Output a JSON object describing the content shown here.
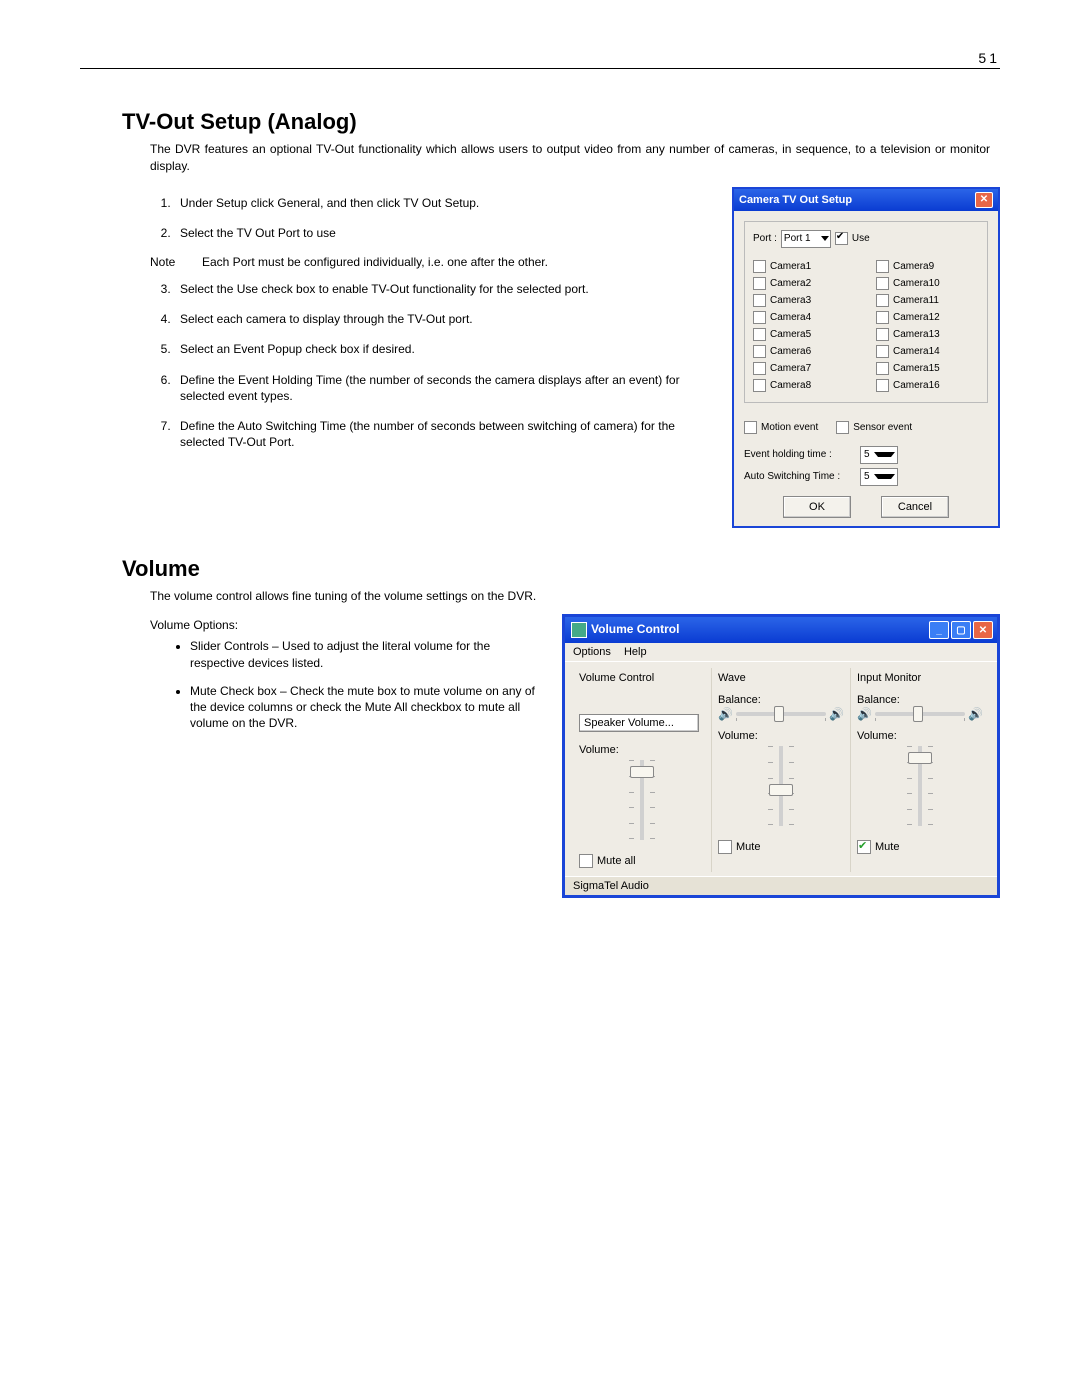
{
  "pageNumber": "51",
  "section1": {
    "heading": "TV-Out Setup (Analog)",
    "intro": "The DVR features an optional TV-Out functionality which allows users to output video from any number of cameras, in sequence, to a television or monitor display.",
    "steps": [
      "Under Setup click General, and then click TV Out Setup.",
      "Select the TV Out Port to use"
    ],
    "noteLabel": "Note",
    "noteText": "Each Port must be configured individually, i.e. one after the other.",
    "steps2": [
      "Select the Use check box to enable TV-Out functionality for the selected port.",
      "Select each camera to display through the TV-Out port.",
      "Select an Event Popup check box if desired.",
      "Define the Event Holding Time (the number of seconds the camera displays after an event) for selected event types.",
      "Define the Auto Switching Time (the number of seconds between switching of camera) for the selected TV-Out Port."
    ]
  },
  "dlg1": {
    "title": "Camera TV Out Setup",
    "portLabel": "Port :",
    "portValue": "Port 1",
    "useLabel": "Use",
    "camerasLeft": [
      "Camera1",
      "Camera2",
      "Camera3",
      "Camera4",
      "Camera5",
      "Camera6",
      "Camera7",
      "Camera8"
    ],
    "camerasRight": [
      "Camera9",
      "Camera10",
      "Camera11",
      "Camera12",
      "Camera13",
      "Camera14",
      "Camera15",
      "Camera16"
    ],
    "motionLabel": "Motion event",
    "sensorLabel": "Sensor event",
    "holdingLabel": "Event holding time :",
    "holdingValue": "5",
    "autoLabel": "Auto Switching Time :",
    "autoValue": "5",
    "ok": "OK",
    "cancel": "Cancel"
  },
  "section2": {
    "heading": "Volume",
    "intro": "The volume control allows fine tuning of the volume settings on the DVR.",
    "optsLabel": "Volume Options:",
    "bullets": [
      "Slider Controls – Used to adjust the literal volume for the respective devices listed.",
      "Mute Check box – Check the mute box to mute volume on any of the device columns or check the Mute All checkbox to mute all volume on the DVR."
    ]
  },
  "dlg2": {
    "title": "Volume Control",
    "menuOptions": "Options",
    "menuHelp": "Help",
    "col1": {
      "heading": "Volume Control",
      "speakerBtn": "Speaker Volume...",
      "volLabel": "Volume:",
      "muteLabel": "Mute all"
    },
    "col2": {
      "heading": "Wave",
      "balLabel": "Balance:",
      "volLabel": "Volume:",
      "muteLabel": "Mute"
    },
    "col3": {
      "heading": "Input Monitor",
      "balLabel": "Balance:",
      "volLabel": "Volume:",
      "muteLabel": "Mute",
      "muteChecked": true
    },
    "status": "SigmaTel Audio"
  }
}
